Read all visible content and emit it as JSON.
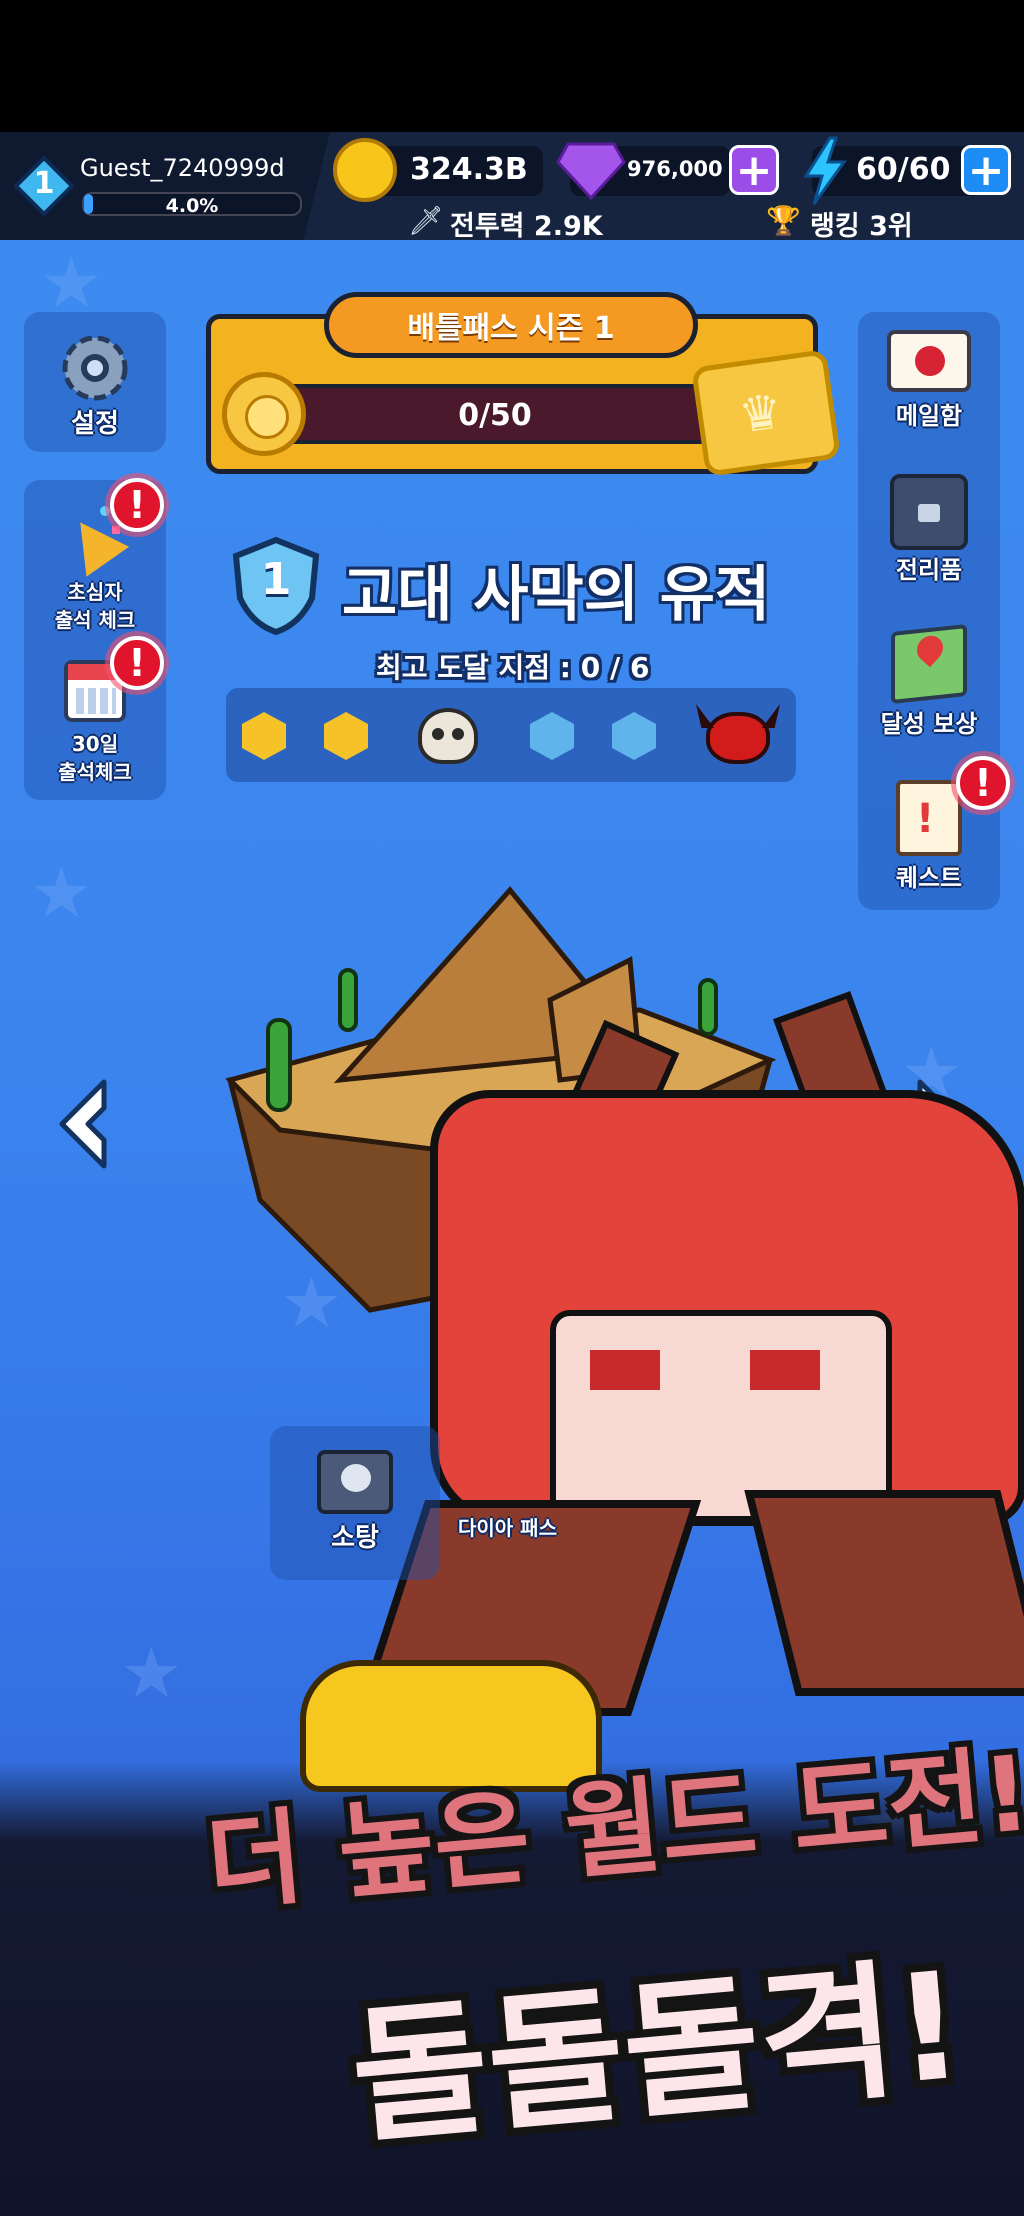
{
  "player": {
    "level": "1",
    "name": "Guest_7240999d",
    "exp_text": "4.0%",
    "exp_fraction": 0.04
  },
  "currencies": {
    "gold": "324.3B",
    "gems": "976,000",
    "energy": "60/60"
  },
  "stats": {
    "combat_power": "전투력 2.9K",
    "ranking": "랭킹 3위"
  },
  "battle_pass": {
    "title": "배틀패스 시즌 1",
    "progress_text": "0/50",
    "progress_fraction": 0
  },
  "left_menu": {
    "settings": "설정",
    "beginner_line1": "초심자",
    "beginner_line2": "출석 체크",
    "day30_line1": "30일",
    "day30_line2": "출석체크"
  },
  "right_menu": {
    "mailbox": "메일함",
    "loot": "전리품",
    "achievement": "달성 보상",
    "quest": "퀘스트"
  },
  "stage": {
    "number": "1",
    "name": "고대 사막의 유적",
    "best_reach": "최고 도달 지점 : 0 / 6"
  },
  "bottom": {
    "sweep": "소탕",
    "dia_pass": "다이아 패스"
  },
  "promo": {
    "line1": "더 높은 월드 도전!",
    "line2": "돌돌돌격!"
  },
  "alert_glyph": "!",
  "plus_glyph": "+",
  "colors": {
    "gold_panel": "#f3b320",
    "alert": "#e0142c",
    "gem_purple": "#9c4de8",
    "energy_blue": "#1d8cf5",
    "promo_pink": "#f7a0a8"
  }
}
